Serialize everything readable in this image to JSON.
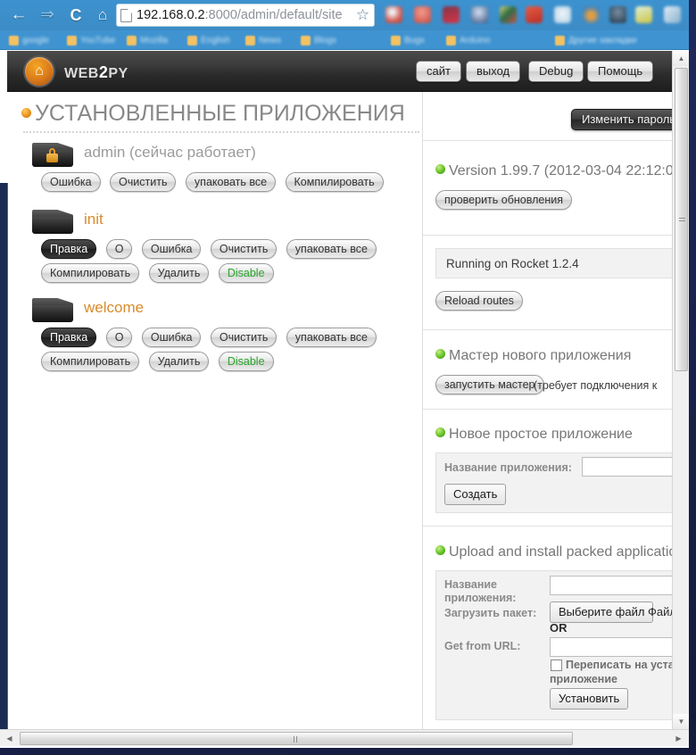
{
  "browser": {
    "nav": {
      "back": "←",
      "forward": "⇒",
      "reload": "C",
      "home": "⌂"
    },
    "url": {
      "host": "192.168.0.2",
      "rest": ":8000/admin/default/site",
      "star": "☆"
    },
    "extension_icons": [
      "cloud-sync-icon",
      "red-dot-icon",
      "crimson-square-icon",
      "blue-badge-icon",
      "bookmark-colorful-icon",
      "red-square-icon",
      "white-cloud-icon",
      "small-orange-icon",
      "dark-shield-icon",
      "yellow-note-icon",
      "wrench-icon"
    ],
    "bookmarks": [
      {
        "icon": "folder-icon",
        "label": "google"
      },
      {
        "icon": "folder-icon",
        "label": "YouTube"
      },
      {
        "icon": "folder-icon",
        "label": "Mozilla"
      },
      {
        "icon": "folder-icon",
        "label": "English"
      },
      {
        "icon": "folder-icon",
        "label": "News"
      },
      {
        "icon": "folder-icon",
        "label": "Blogs"
      },
      {
        "icon": "folder-icon",
        "label": "Bugs"
      },
      {
        "icon": "folder-icon",
        "label": "Arduino"
      },
      {
        "icon": "folder-icon",
        "label": "Другие закладки"
      }
    ]
  },
  "header": {
    "logo_glyph": "⌂",
    "wordmark_pre": "WEB",
    "wordmark_two": "2",
    "wordmark_post": "PY",
    "nav_buttons": [
      {
        "name": "site",
        "label": "сайт"
      },
      {
        "name": "logout",
        "label": "выход"
      },
      {
        "name": "debug",
        "label": "Debug"
      },
      {
        "name": "help",
        "label": "Помощь"
      }
    ]
  },
  "apps_panel": {
    "title": "УСТАНОВЛЕННЫЕ ПРИЛОЖЕНИЯ",
    "apps": [
      {
        "name": "admin (сейчас работает)",
        "locked": true,
        "rows": [
          [
            {
              "label": "Ошибка",
              "style": "normal"
            },
            {
              "label": "Очистить",
              "style": "normal"
            },
            {
              "label": "упаковать все",
              "style": "normal"
            },
            {
              "label": "Компилировать",
              "style": "normal"
            }
          ]
        ]
      },
      {
        "name": "init",
        "locked": false,
        "rows": [
          [
            {
              "label": "Правка",
              "style": "dark"
            },
            {
              "label": "О",
              "style": "normal"
            },
            {
              "label": "Ошибка",
              "style": "normal"
            },
            {
              "label": "Очистить",
              "style": "normal"
            },
            {
              "label": "упаковать все",
              "style": "normal"
            }
          ],
          [
            {
              "label": "Компилировать",
              "style": "normal"
            },
            {
              "label": "Удалить",
              "style": "normal"
            },
            {
              "label": "Disable",
              "style": "green"
            }
          ]
        ]
      },
      {
        "name": "welcome",
        "locked": false,
        "rows": [
          [
            {
              "label": "Правка",
              "style": "dark"
            },
            {
              "label": "О",
              "style": "normal"
            },
            {
              "label": "Ошибка",
              "style": "normal"
            },
            {
              "label": "Очистить",
              "style": "normal"
            },
            {
              "label": "упаковать все",
              "style": "normal"
            }
          ],
          [
            {
              "label": "Компилировать",
              "style": "normal"
            },
            {
              "label": "Удалить",
              "style": "normal"
            },
            {
              "label": "Disable",
              "style": "green"
            }
          ]
        ]
      }
    ]
  },
  "sidebar": {
    "change_password_button": "Изменить пароль ад",
    "version": {
      "text": "Version 1.99.7 (2012-03-04 22:12:0",
      "check_updates_button": "проверить обновления"
    },
    "server": {
      "status": "Running on Rocket 1.2.4",
      "reload_routes_button": "Reload routes"
    },
    "wizard": {
      "title": "Мастер нового приложения",
      "button": "запустить мастер",
      "note": "(требует подключения к"
    },
    "simple_app": {
      "title": "Новое простое приложение",
      "name_label": "Название приложения:",
      "name_value": "",
      "create_button": "Создать"
    },
    "upload": {
      "title": "Upload and install packed applicatio",
      "name_label_line1": "Название",
      "name_label_line2": "приложения:",
      "name_value": "",
      "packet_label": "Загрузить пакет:",
      "choose_file_button": "Выберите файл",
      "file_status": "Файл",
      "or_text": "OR",
      "url_label": "Get from URL:",
      "url_value": "",
      "overwrite_line1": "Переписать на уста",
      "overwrite_line2": "приложение",
      "install_button": "Установить"
    }
  },
  "scrollbars": {
    "up_arrow": "▲",
    "down_arrow": "▼",
    "left_arrow": "◀",
    "right_arrow": "▶"
  }
}
